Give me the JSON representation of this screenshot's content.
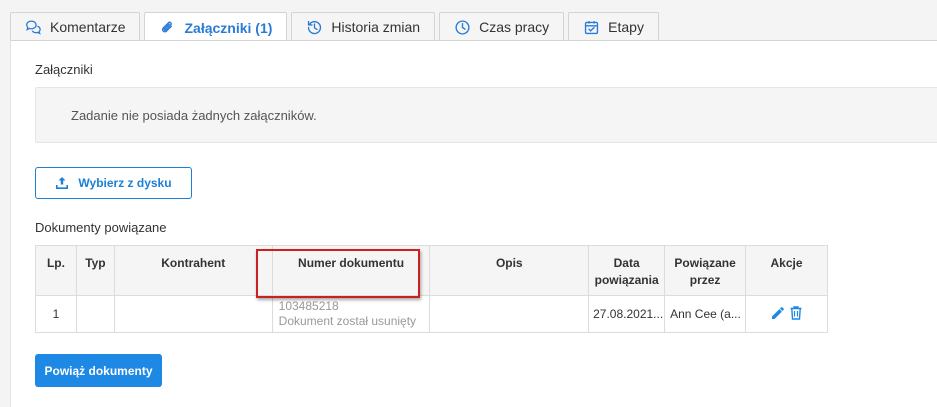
{
  "tabs": [
    {
      "label": "Komentarze",
      "icon": "comments-icon"
    },
    {
      "label": "Załączniki (1)",
      "icon": "paperclip-icon"
    },
    {
      "label": "Historia zmian",
      "icon": "history-icon"
    },
    {
      "label": "Czas pracy",
      "icon": "clock-icon"
    },
    {
      "label": "Etapy",
      "icon": "calendar-check-icon"
    }
  ],
  "attachments": {
    "heading": "Załączniki",
    "empty_message": "Zadanie nie posiada żadnych załączników.",
    "upload_label": "Wybierz z dysku"
  },
  "related": {
    "heading": "Dokumenty powiązane",
    "columns": [
      "Lp.",
      "Typ",
      "Kontrahent",
      "Numer dokumentu",
      "Opis",
      "Data powiązania",
      "Powiązane przez",
      "Akcje"
    ],
    "rows": [
      {
        "lp": "1",
        "typ": "",
        "kontrahent": "",
        "numer": "103485218",
        "numer_note": "Dokument został usunięty",
        "opis": "",
        "data": "27.08.2021...",
        "przez": "Ann Cee (a..."
      }
    ],
    "link_label": "Powiąż dokumenty"
  },
  "colors": {
    "accent": "#1e88e5",
    "highlight": "#cc1f1f"
  }
}
